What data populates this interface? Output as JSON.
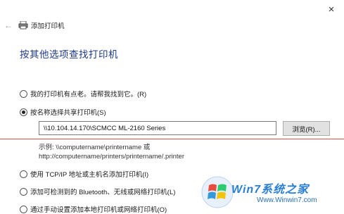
{
  "window": {
    "close_symbol": "×"
  },
  "header": {
    "title": "添加打印机",
    "back_symbol": "←"
  },
  "page": {
    "title": "按其他选项查找打印机"
  },
  "options": [
    {
      "label": "我的打印机有点老。请帮我找到它。(R)",
      "checked": false
    },
    {
      "label": "按名称选择共享打印机(S)",
      "checked": true
    },
    {
      "label": "使用 TCP/IP 地址或主机名添加打印机(I)",
      "checked": false
    },
    {
      "label": "添加可检测到的 Bluetooth、无线或网络打印机(L)",
      "checked": false
    },
    {
      "label": "通过手动设置添加本地打印机或网络打印机(O)",
      "checked": false
    }
  ],
  "share_input": {
    "value": "\\\\10.104.14.170\\SCMCC ML-2160 Series"
  },
  "browse_button": {
    "label": "浏览(R)..."
  },
  "example": {
    "line1": "示例: \\\\computername\\printername 或",
    "line2": "http://computername/printers/printername/.printer"
  },
  "watermark": {
    "brand": "Win7系统之家",
    "url": "Www.Winwin7.com"
  },
  "colors": {
    "title": "#1e3a8a",
    "divider": "#d9534f",
    "brand": "#2a7fd4"
  }
}
